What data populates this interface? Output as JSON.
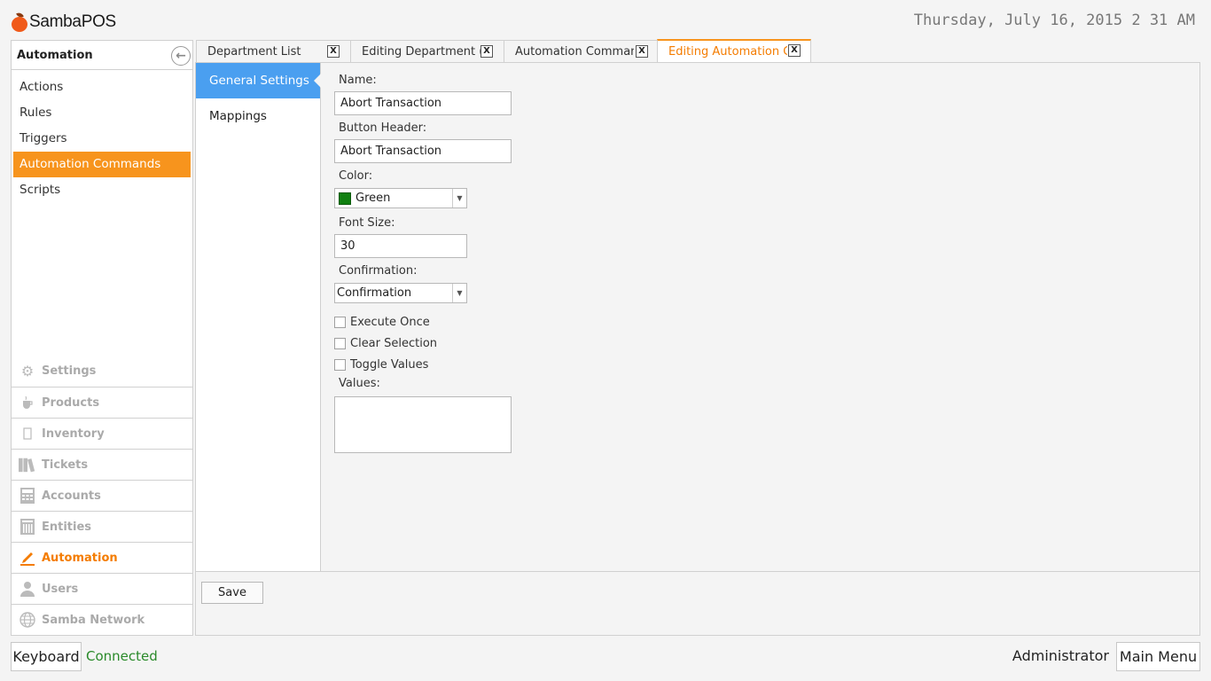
{
  "app": {
    "logo_text": "SambaPOS",
    "datetime": "Thursday, July 16, 2015 2 31 AM"
  },
  "sidebar": {
    "header": "Automation",
    "items": [
      {
        "label": "Actions",
        "active": false
      },
      {
        "label": "Rules",
        "active": false
      },
      {
        "label": "Triggers",
        "active": false
      },
      {
        "label": "Automation Commands",
        "active": true
      },
      {
        "label": "Scripts",
        "active": false
      }
    ],
    "nav": [
      {
        "label": "Settings",
        "icon": "gear-icon",
        "active": false
      },
      {
        "label": "Products",
        "icon": "cup-icon",
        "active": false
      },
      {
        "label": "Inventory",
        "icon": "box-icon",
        "active": false
      },
      {
        "label": "Tickets",
        "icon": "books-icon",
        "active": false
      },
      {
        "label": "Accounts",
        "icon": "calculator-icon",
        "active": false
      },
      {
        "label": "Entities",
        "icon": "grid-icon",
        "active": false
      },
      {
        "label": "Automation",
        "icon": "pencil-icon",
        "active": true
      },
      {
        "label": "Users",
        "icon": "user-icon",
        "active": false
      },
      {
        "label": "Samba Network",
        "icon": "globe-icon",
        "active": false
      }
    ]
  },
  "tabs": [
    {
      "label": "Department List",
      "close": "X",
      "active": false
    },
    {
      "label": "Editing Department (F",
      "close": "X",
      "active": false
    },
    {
      "label": "Automation Comman",
      "close": "X",
      "active": false
    },
    {
      "label": "Editing Automation C",
      "close": "X",
      "active": true
    }
  ],
  "subnav": [
    {
      "label": "General Settings",
      "active": true
    },
    {
      "label": "Mappings",
      "active": false
    }
  ],
  "form": {
    "name_label": "Name:",
    "name_value": "Abort Transaction",
    "button_header_label": "Button Header:",
    "button_header_value": "Abort Transaction",
    "color_label": "Color:",
    "color_value": "Green",
    "color_swatch": "#108010",
    "font_size_label": "Font Size:",
    "font_size_value": "30",
    "confirmation_label": "Confirmation:",
    "confirmation_value": "Confirmation",
    "execute_once_label": "Execute Once",
    "clear_selection_label": "Clear Selection",
    "toggle_values_label": "Toggle Values",
    "values_label": "Values:"
  },
  "footer": {
    "save_label": "Save"
  },
  "statusbar": {
    "keyboard_label": "Keyboard",
    "connection_status": "Connected",
    "user": "Administrator",
    "main_menu_label": "Main Menu"
  },
  "colors": {
    "accent": "#f7941d",
    "subnav_active": "#4a9ff0",
    "connected": "#2a8a2a"
  }
}
